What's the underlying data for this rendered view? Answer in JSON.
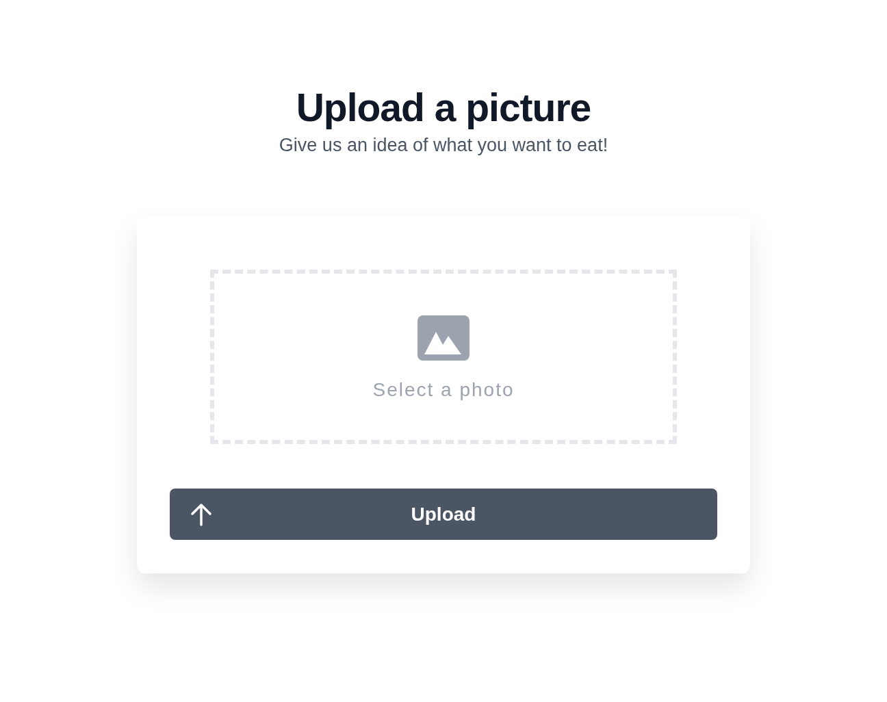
{
  "header": {
    "title": "Upload a picture",
    "subtitle": "Give us an idea of what you want to eat!"
  },
  "dropzone": {
    "label": "Select a photo"
  },
  "upload_button": {
    "label": "Upload"
  }
}
